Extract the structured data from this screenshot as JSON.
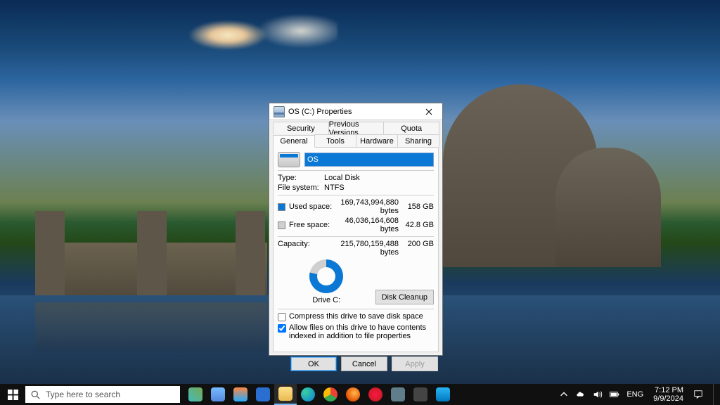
{
  "dialog": {
    "title": "OS (C:) Properties",
    "tabs_row1": [
      "Security",
      "Previous Versions",
      "Quota"
    ],
    "tabs_row2": [
      "General",
      "Tools",
      "Hardware",
      "Sharing"
    ],
    "active_tab": "General",
    "drive_name_value": "OS",
    "type_label": "Type:",
    "type_value": "Local Disk",
    "fs_label": "File system:",
    "fs_value": "NTFS",
    "used_label": "Used space:",
    "used_bytes": "169,743,994,880 bytes",
    "used_gb": "158 GB",
    "free_label": "Free space:",
    "free_bytes": "46,036,164,608 bytes",
    "free_gb": "42.8 GB",
    "capacity_label": "Capacity:",
    "capacity_bytes": "215,780,159,488 bytes",
    "capacity_gb": "200 GB",
    "donut_label": "Drive C:",
    "cleanup_btn": "Disk Cleanup",
    "compress_label": "Compress this drive to save disk space",
    "compress_checked": false,
    "index_label": "Allow files on this drive to have contents indexed in addition to file properties",
    "index_checked": true,
    "ok": "OK",
    "cancel": "Cancel",
    "apply": "Apply"
  },
  "taskbar": {
    "search_placeholder": "Type here to search",
    "lang": "ENG",
    "time": "7:12 PM",
    "date": "9/9/2024"
  }
}
